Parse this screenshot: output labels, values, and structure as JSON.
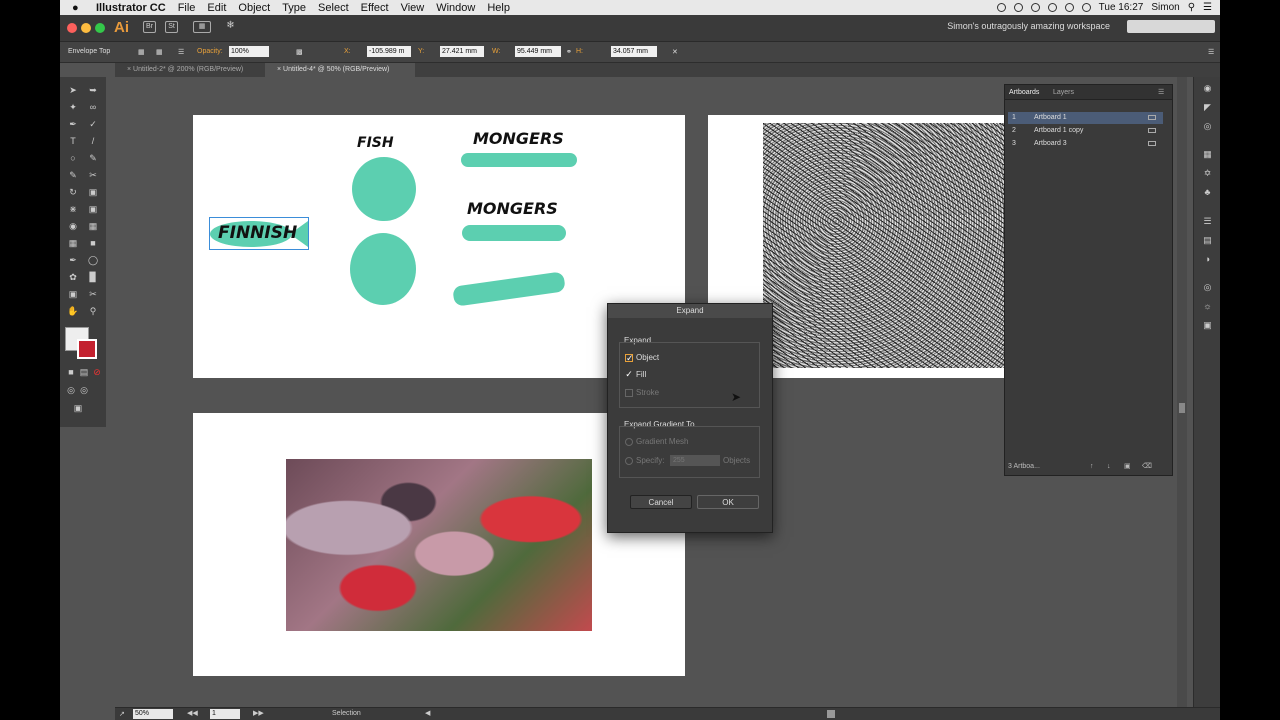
{
  "menubar": {
    "apple": "",
    "app_name": "Illustrator CC",
    "items": [
      "File",
      "Edit",
      "Object",
      "Type",
      "Select",
      "Effect",
      "View",
      "Window",
      "Help"
    ],
    "clock": "Tue 16:27",
    "user": "Simon"
  },
  "appbar": {
    "logo": "Ai",
    "btn_br": "Br",
    "btn_st": "St",
    "workspace": "Simon's outragously amazing workspace"
  },
  "control_bar": {
    "object_type": "Envelope Top",
    "opacity_label": "Opacity:",
    "opacity_value": "100%",
    "x_label": "X:",
    "x_value": "-105.989 m",
    "y_label": "Y:",
    "y_value": "27.421 mm",
    "w_label": "W:",
    "w_value": "95.449 mm",
    "h_label": "H:",
    "h_value": "34.057 mm"
  },
  "tabs": [
    {
      "label": "Untitled-2* @ 200% (RGB/Preview)",
      "active": false
    },
    {
      "label": "Untitled-4* @ 50% (RGB/Preview)",
      "active": true
    }
  ],
  "artwork": {
    "fish_title": "FISH",
    "mongers_1": "MONGERS",
    "mongers_2": "MONGERS",
    "finnish": "FINNISH",
    "accent": "#5ccfb0"
  },
  "expand_dialog": {
    "title": "Expand",
    "section_expand": "Expand",
    "object_label": "Object",
    "object_checked": true,
    "fill_label": "Fill",
    "fill_checked": true,
    "stroke_label": "Stroke",
    "section_gradient": "Expand Gradient To",
    "gradient_mesh_label": "Gradient Mesh",
    "specify_label": "Specify:",
    "specify_value": "255",
    "objects_label": "Objects",
    "cancel_label": "Cancel",
    "ok_label": "OK"
  },
  "artboards_panel": {
    "tab_artboards": "Artboards",
    "tab_layers": "Layers",
    "rows": [
      {
        "num": "1",
        "name": "Artboard 1",
        "selected": true
      },
      {
        "num": "2",
        "name": "Artboard 1 copy",
        "selected": false
      },
      {
        "num": "3",
        "name": "Artboard 3",
        "selected": false
      }
    ],
    "footer": "3 Artboa..."
  },
  "status_bar": {
    "zoom": "50%",
    "artboard_num": "1",
    "tool_name": "Selection"
  }
}
